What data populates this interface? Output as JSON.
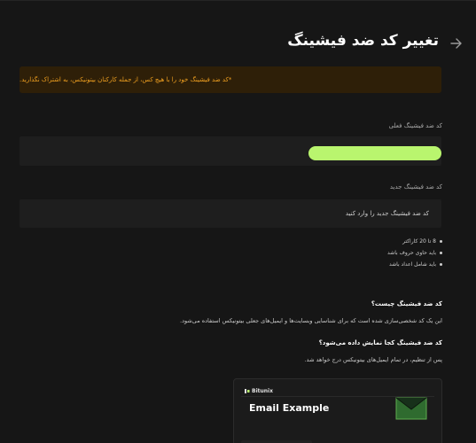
{
  "header": {
    "title": "تغییر کد ضد فیشینگ",
    "back_icon": "arrow-right-icon"
  },
  "warning": {
    "text": "*کد ضد فیشینگ خود را با هیچ کس، از جمله کارکنان بیتونیکس، به اشتراک نگذارید.",
    "color": "#f0a020",
    "background": "#2e1f08"
  },
  "current_code": {
    "label": "کد ضد فیشینگ فعلی",
    "highlight_color": "#b9f56e"
  },
  "new_code": {
    "label": "کد ضد فیشینگ جدید",
    "placeholder": "کد ضد فیشینگ جدید را وارد کنید",
    "value": ""
  },
  "rules": [
    "8 تا 20 کاراکتر",
    "باید حاوی حروف باشد",
    "باید شامل اعداد باشد"
  ],
  "faq": [
    {
      "question": "کد ضد فیشینگ چیست؟",
      "answer": "این یک کد شخصی‌سازی شده است که برای شناسایی وبسایت‌ها و ایمیل‌های جعلی بیتونیکس استفاده می‌شود."
    },
    {
      "question": "کد ضد فیشینگ کجا نمایش داده می‌شود؟",
      "answer": "پس از تنظیم، در تمام ایمیل‌های بیتونیکس درج خواهد شد."
    }
  ],
  "email_preview": {
    "brand": "Bitunix",
    "title": "Email Example",
    "icon": "envelope-icon"
  }
}
